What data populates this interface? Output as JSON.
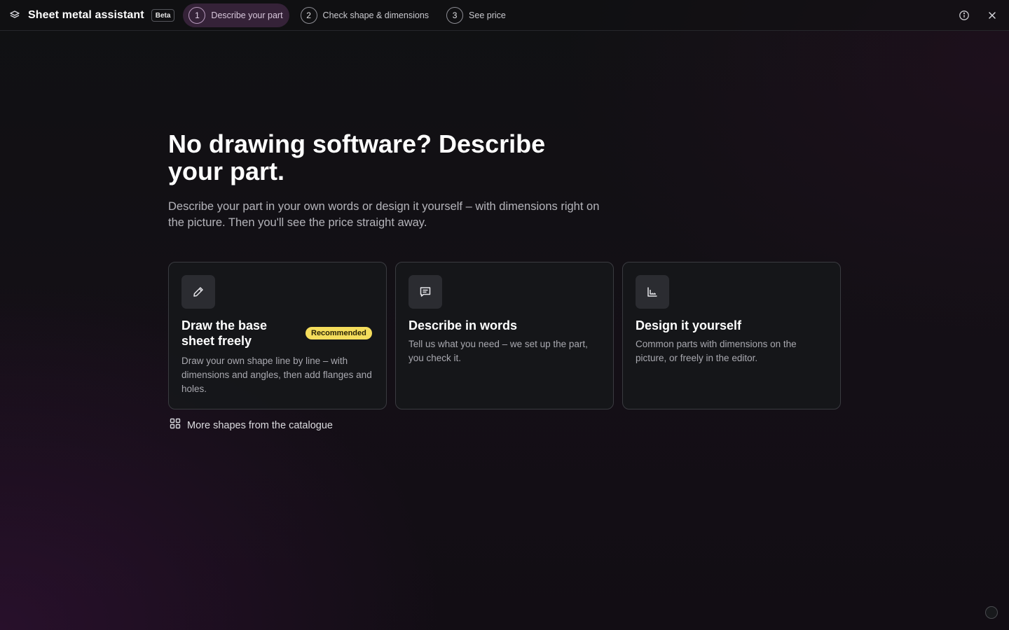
{
  "app": {
    "title": "Sheet metal assistant",
    "badge": "Beta",
    "logo_icon": "layers-icon"
  },
  "steps": [
    {
      "number": "1",
      "label": "Describe your part",
      "active": true
    },
    {
      "number": "2",
      "label": "Check shape & dimensions",
      "active": false
    },
    {
      "number": "3",
      "label": "See price",
      "active": false
    }
  ],
  "top_actions": {
    "info_icon": "info-icon",
    "close_icon": "close-icon"
  },
  "hero": {
    "title": "No drawing software? Describe your part.",
    "subtitle": "Describe your part in your own words or design it yourself – with dimensions right on the picture. Then you'll see the price straight away."
  },
  "cards": [
    {
      "icon": "pencil-icon",
      "title": "Draw the base sheet freely",
      "badge": "Recommended",
      "description": "Draw your own shape line by line – with dimensions and angles, then add flanges and holes."
    },
    {
      "icon": "message-icon",
      "title": "Describe in words",
      "description": "Tell us what you need – we set up the part, you check it."
    },
    {
      "icon": "profile-icon",
      "title": "Design it yourself",
      "description": "Common parts with dimensions on the picture, or freely in the editor."
    }
  ],
  "catalogue": {
    "icon": "grid-icon",
    "label": "More shapes from the catalogue"
  },
  "colors": {
    "accent_active_step": "#352238",
    "badge_yellow": "#f4dd5c",
    "background": "#101113"
  }
}
